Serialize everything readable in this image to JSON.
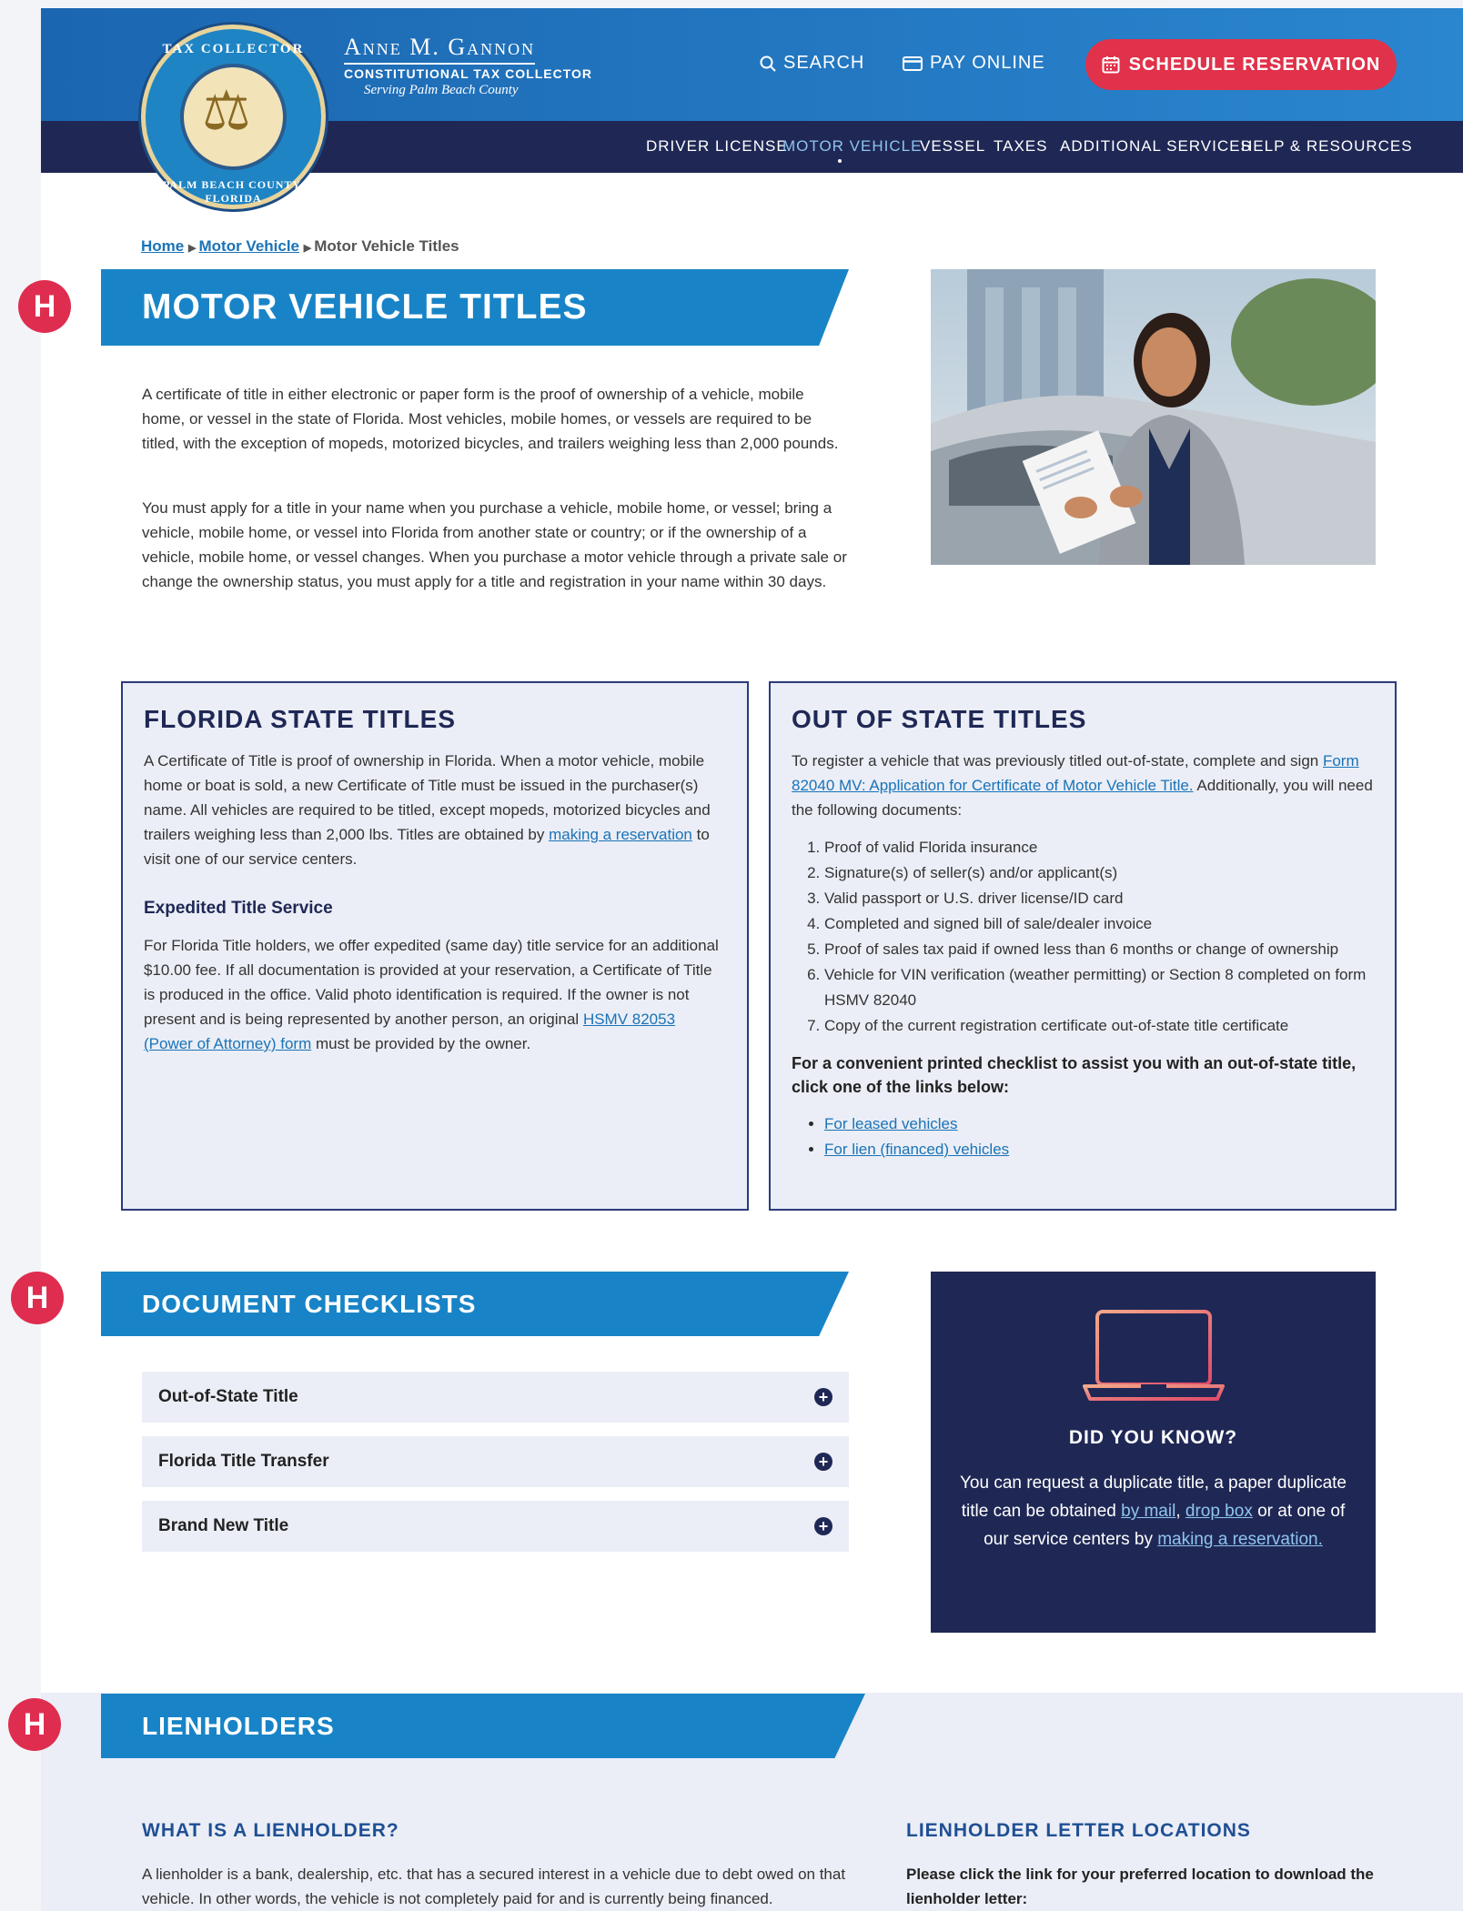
{
  "header": {
    "brand_name": "Anne M. Gannon",
    "brand_subtitle": "CONSTITUTIONAL TAX COLLECTOR",
    "brand_tagline": "Serving Palm Beach County",
    "seal_text_top": "TAX COLLECTOR",
    "seal_text_bottom": "PALM BEACH COUNTY, FLORIDA",
    "search_label": "SEARCH",
    "pay_label": "PAY ONLINE",
    "schedule_label": "SCHEDULE RESERVATION"
  },
  "nav": {
    "items": [
      {
        "label": "DRIVER LICENSE"
      },
      {
        "label": "MOTOR VEHICLE"
      },
      {
        "label": "VESSEL"
      },
      {
        "label": "TAXES"
      },
      {
        "label": "ADDITIONAL SERVICES"
      },
      {
        "label": "HELP & RESOURCES"
      }
    ]
  },
  "breadcrumb": {
    "home": "Home",
    "section": "Motor Vehicle",
    "current": "Motor Vehicle Titles"
  },
  "badge_letter": "H",
  "page_title": "MOTOR VEHICLE TITLES",
  "intro": {
    "p1": "A certificate of title in either electronic or paper form is the proof of ownership of a vehicle, mobile home, or vessel in the state of Florida. Most vehicles, mobile homes, or vessels are required to be titled, with the exception of mopeds, motorized bicycles, and trailers weighing less than 2,000 pounds.",
    "p2": "You must apply for a title in your name when you purchase a vehicle, mobile home, or vessel; bring a vehicle, mobile home, or vessel into Florida from another state or country; or if the ownership of a vehicle, mobile home, or vessel changes. When you purchase a motor vehicle through a private sale or change the ownership status, you must apply for a title and registration in your name within 30 days."
  },
  "florida_box": {
    "title": "FLORIDA STATE TITLES",
    "p1_before": "A Certificate of Title is proof of ownership in Florida. When a motor vehicle, mobile home or boat is sold, a new Certificate of Title must be issued in the purchaser(s) name. All vehicles are required to be titled, except mopeds, motorized bicycles and trailers weighing less than 2,000 lbs. Titles are obtained by ",
    "p1_link": "making a reservation",
    "p1_after": " to visit one of our service centers.",
    "subtitle": "Expedited Title Service",
    "p2_before": "For Florida Title holders, we offer expedited (same day) title service for an additional $10.00 fee. If all documentation is provided at your reservation, a Certificate of Title is produced in the office. Valid photo identification is required. If the owner is not present and is being represented by another person, an original ",
    "p2_link": "HSMV 82053 (Power of Attorney) form",
    "p2_after": " must be provided by the owner."
  },
  "oos_box": {
    "title": "OUT OF STATE TITLES",
    "p1_before": "To register a vehicle that was previously titled out-of-state, complete and sign ",
    "p1_link": "Form 82040 MV: Application for Certificate of Motor Vehicle Title.",
    "p1_after": " Additionally, you will need the following documents:",
    "items": [
      "Proof of valid Florida insurance",
      "Signature(s) of seller(s) and/or applicant(s)",
      "Valid passport or U.S. driver license/ID card",
      "Completed and signed bill of sale/dealer invoice",
      "Proof of sales tax paid if owned less than 6 months or change of ownership",
      "Vehicle for VIN verification (weather permitting) or Section 8 completed on form HSMV 82040",
      "Copy of the current registration certificate out-of-state title certificate"
    ],
    "checklist_note": "For a convenient printed checklist to assist you with an out-of-state title, click one of the links below:",
    "links": [
      "For leased vehicles",
      "For lien (financed) vehicles"
    ]
  },
  "checklists": {
    "title": "DOCUMENT CHECKLISTS",
    "items": [
      "Out-of-State Title",
      "Florida Title Transfer",
      "Brand New Title"
    ]
  },
  "did_you_know": {
    "title": "DID YOU KNOW?",
    "text1": "You can request a duplicate title, a paper duplicate title can be obtained ",
    "link1": "by mail",
    "sep": ", ",
    "link2": "drop box",
    "text2": " or at one of our service centers by ",
    "link3": "making a reservation."
  },
  "lienholders": {
    "title": "LIENHOLDERS",
    "what_title": "WHAT IS A LIENHOLDER?",
    "what_text": "A lienholder is a bank, dealership, etc. that has a secured interest in a vehicle due to debt owed on that vehicle. In other words, the vehicle is not completely paid for and is currently being financed.",
    "loc_title": "LIENHOLDER LETTER LOCATIONS",
    "loc_text": "Please click the link for your preferred location to download the lienholder letter:"
  },
  "colors": {
    "primary_blue": "#1884c7",
    "navy": "#1f2855",
    "accent_red": "#e0324a",
    "badge_red": "#df2d4f"
  }
}
